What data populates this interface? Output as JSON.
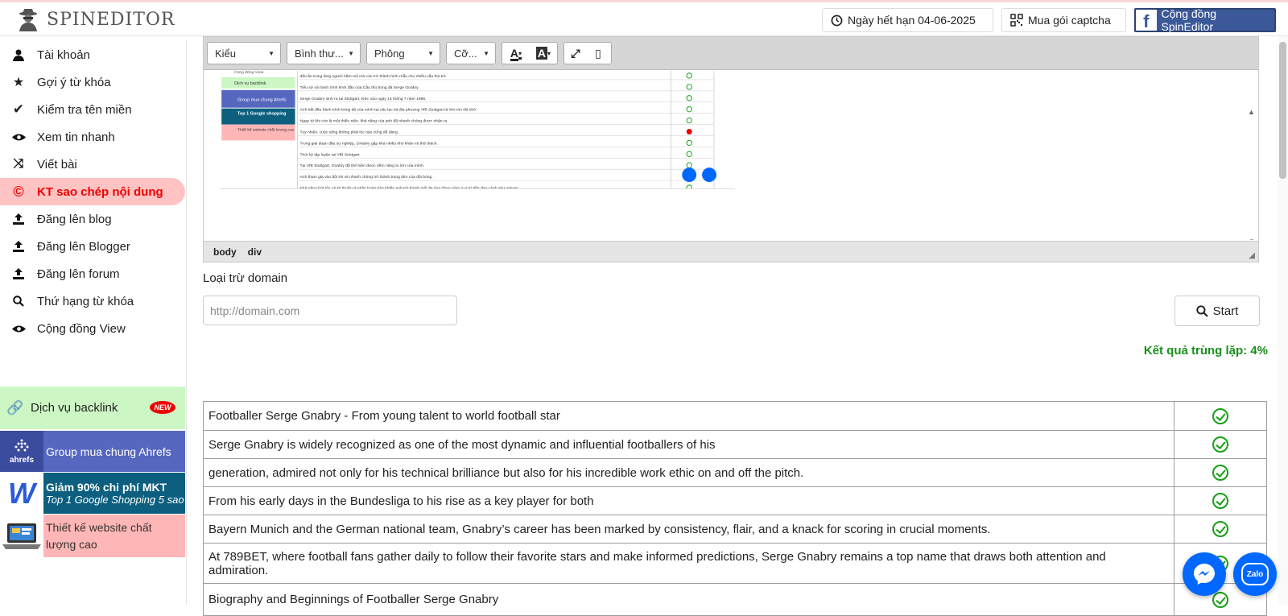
{
  "header": {
    "logo_text": "SPINEDITOR",
    "expiry_label": "Ngày hết hạn 04-06-2025",
    "captcha_label": "Mua gói captcha",
    "community_label": "Cộng đồng SpinEditor",
    "fb_letter": "f"
  },
  "sidebar": {
    "items": [
      {
        "label": "Tài khoản",
        "icon": "user-icon"
      },
      {
        "label": "Gợi ý từ khóa",
        "icon": "star-icon"
      },
      {
        "label": "Kiểm tra tên miền",
        "icon": "check-icon"
      },
      {
        "label": "Xem tin nhanh",
        "icon": "eye-icon"
      },
      {
        "label": "Viết bài",
        "icon": "shuffle-icon"
      },
      {
        "label": "KT sao chép nội dung",
        "icon": "copyright-icon",
        "active": true
      },
      {
        "label": "Đăng lên blog",
        "icon": "upload-icon"
      },
      {
        "label": "Đăng lên Blogger",
        "icon": "upload-icon"
      },
      {
        "label": "Đăng lên forum",
        "icon": "upload-icon"
      },
      {
        "label": "Thứ hạng từ khóa",
        "icon": "search-icon"
      },
      {
        "label": "Cộng đồng View",
        "icon": "eye-icon"
      }
    ],
    "backlink_label": "Dịch vụ backlink",
    "new_badge": "NEW",
    "promos": {
      "ahrefs_label": "Group mua chung Ahrefs",
      "ahrefs_logo": "ahrefs",
      "mkt_title": "Giảm 90% chi phí MKT",
      "mkt_subtitle": "Top 1 Google Shopping 5 sao",
      "web_label": "Thiết kế website chất lượng cao"
    }
  },
  "editor": {
    "dropdowns": [
      "Kiểu",
      "Bình thư...",
      "Phông",
      "Cỡ..."
    ],
    "path": [
      "body",
      "div"
    ],
    "embedded_screenshot": {
      "sidebar_items": [
        "Cộng đồng View",
        "Dịch vụ backlink",
        "Group mua chung Ahrefs",
        "Top 1 Google shopping",
        "Thiết kế website chất lượng cao"
      ],
      "rows": [
        {
          "text": "dấu ấn trong lòng người hâm mộ mà còn trở thành hình mẫu cho nhiều cầu thủ trẻ.",
          "status": "ok"
        },
        {
          "text": "Tiểu sử và hành trình khởi đầu của Cầu thủ bóng đá Serge Gnabry",
          "status": "ok"
        },
        {
          "text": "Serge Gnabry sinh ra tại Stuttgart, Đức vào ngày 14 tháng 7 năm 1995.",
          "status": "ok"
        },
        {
          "text": "Anh bắt đầu hành trình bóng đá của mình tại câu lạc bộ địa phương VfB Stuttgart từ khi còn rất nhỏ.",
          "status": "ok"
        },
        {
          "text": "Ngay từ khi còn là một thiếu niên, khả năng của anh đã nhanh chóng được nhận ra.",
          "status": "ok"
        },
        {
          "text": "Tuy nhiên, cuộc sống không phải lúc nào cũng dễ dàng.",
          "status": "error"
        },
        {
          "text": "Trong giai đoạn đầu sự nghiệp, GNabry gặp khá nhiều khó khăn và thử thách.",
          "status": "ok"
        },
        {
          "text": "Thời kỳ tập luyện tại VfB Stuttgart",
          "status": "ok"
        },
        {
          "text": "Tại VfB Stuttgart, Gnabry đã thể hiện được tiềm năng to lớn của mình.",
          "status": "ok"
        },
        {
          "text": "Anh tham gia vào đội trẻ và nhanh chóng trở thành trung tâm của đội bóng.",
          "status": "ok"
        },
        {
          "text": "Khả năng bứt tốc và kỹ thuật cá nhân hoàn hảo khiến anh trở thành mối đe dọa đáng gờm ở vị trí tiền đạo cánh như winger.",
          "status": "ok"
        }
      ]
    }
  },
  "form": {
    "exclude_label": "Loại trừ domain",
    "domain_placeholder": "http://domain.com",
    "start_label": "Start"
  },
  "result_text": "Kết quả trùng lặp: 4%",
  "results": [
    {
      "text": "Footballer Serge Gnabry - From young talent to world football star",
      "status": "ok"
    },
    {
      "text": "Serge Gnabry is widely recognized as one of the most dynamic and influential footballers of his",
      "status": "ok"
    },
    {
      "text": "generation, admired not only for his technical brilliance but also for his incredible work ethic on and off the pitch.",
      "status": "ok"
    },
    {
      "text": "From his early days in the Bundesliga to his rise as a key player for both",
      "status": "ok"
    },
    {
      "text": "Bayern Munich and the German national team, Gnabry’s career has been marked by consistency, flair, and a knack for scoring in crucial moments.",
      "status": "ok"
    },
    {
      "text": "At 789BET, where football fans gather daily to follow their favorite stars and make informed predictions, Serge Gnabry remains a top name that draws both attention and admiration.",
      "status": "ok"
    },
    {
      "text": "Biography and Beginnings of Footballer Serge Gnabry",
      "status": "ok"
    }
  ],
  "floating": {
    "zalo_label": "Zalo"
  },
  "colors": {
    "active_bg": "#ffc3c3",
    "active_text": "#ee0000",
    "ok_green": "#16a016",
    "result_green": "#1b8f1b",
    "fb_blue": "#3b5998",
    "backlink_bg": "#ccf7c4"
  }
}
